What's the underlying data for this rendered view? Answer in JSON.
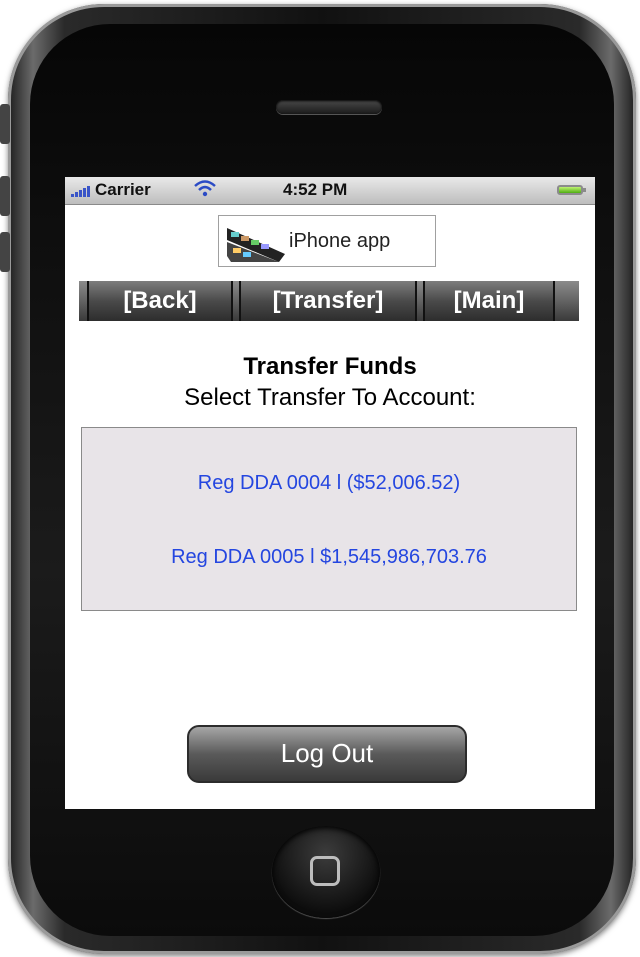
{
  "status_bar": {
    "carrier": "Carrier",
    "time": "4:52 PM",
    "signal_icon": "signal-bars-icon",
    "wifi_icon": "wifi-icon",
    "battery_icon": "battery-icon"
  },
  "logo": {
    "text": "iPhone app",
    "icon": "film-strip-icon"
  },
  "nav": {
    "back": "[Back]",
    "transfer": "[Transfer]",
    "main": "[Main]"
  },
  "page": {
    "title": "Transfer Funds",
    "subtitle": "Select Transfer To Account:"
  },
  "accounts": [
    {
      "label": "Reg DDA 0004 l ($52,006.52)"
    },
    {
      "label": "Reg DDA 0005 l $1,545,986,703.76"
    }
  ],
  "logout_label": "Log Out",
  "colors": {
    "link": "#2446e0",
    "account_box_bg": "#e8e4e8"
  }
}
